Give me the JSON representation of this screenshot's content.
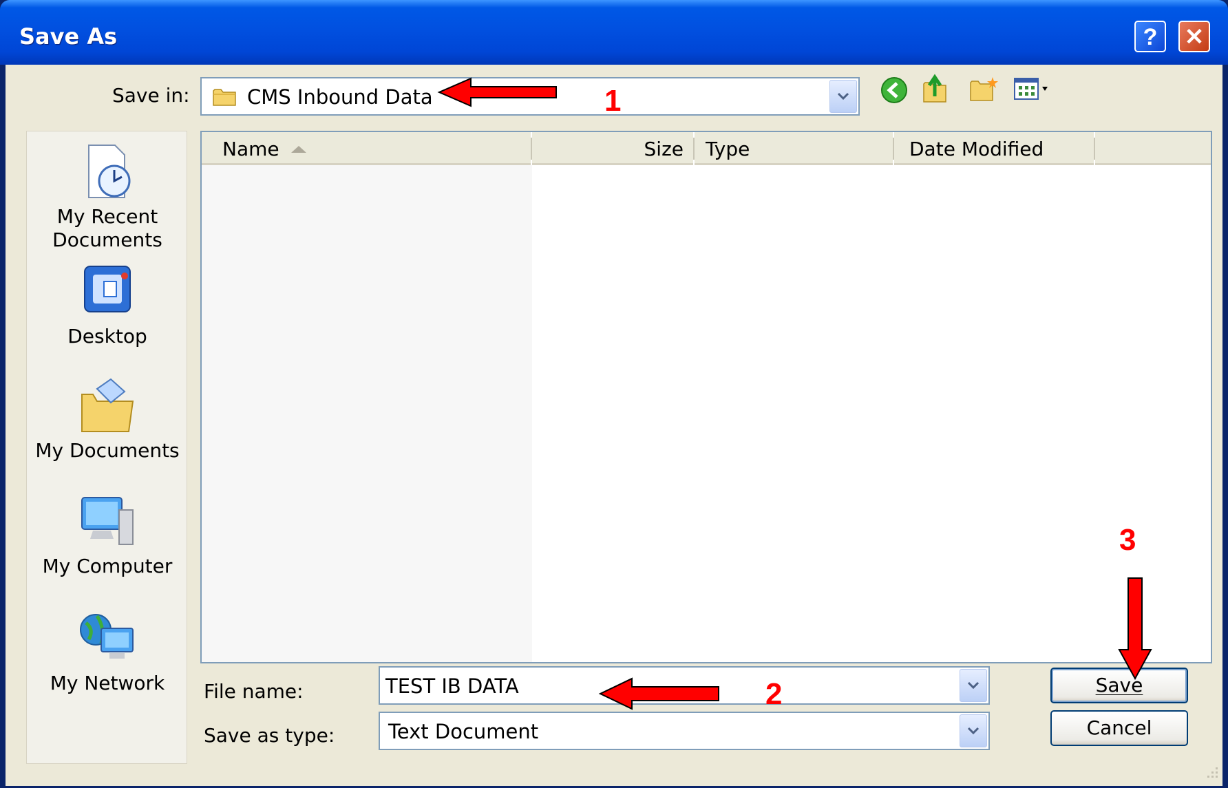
{
  "window": {
    "title": "Save As",
    "help_label": "?",
    "close_label": "✕"
  },
  "save_in": {
    "label": "Save in:",
    "value": "CMS Inbound Data"
  },
  "toolbar": {
    "icons": [
      "back-icon",
      "up-folder-icon",
      "new-folder-icon",
      "views-menu-icon"
    ]
  },
  "places": [
    {
      "label": "My Recent\nDocuments",
      "icon": "recent-documents-icon"
    },
    {
      "label": "Desktop",
      "icon": "desktop-icon"
    },
    {
      "label": "My Documents",
      "icon": "my-documents-icon"
    },
    {
      "label": "My Computer",
      "icon": "my-computer-icon"
    },
    {
      "label": "My Network",
      "icon": "my-network-icon"
    }
  ],
  "columns": {
    "name": "Name",
    "size": "Size",
    "type": "Type",
    "date": "Date Modified"
  },
  "file_name": {
    "label": "File name:",
    "value": "TEST IB DATA"
  },
  "save_as_type": {
    "label": "Save as type:",
    "value": "Text Document"
  },
  "buttons": {
    "save": "Save",
    "cancel": "Cancel"
  },
  "annotations": {
    "one": "1",
    "two": "2",
    "three": "3"
  },
  "colors": {
    "title_bar": "#0054e3",
    "annotation": "#ff0000",
    "dialog_bg": "#ece9d8"
  }
}
